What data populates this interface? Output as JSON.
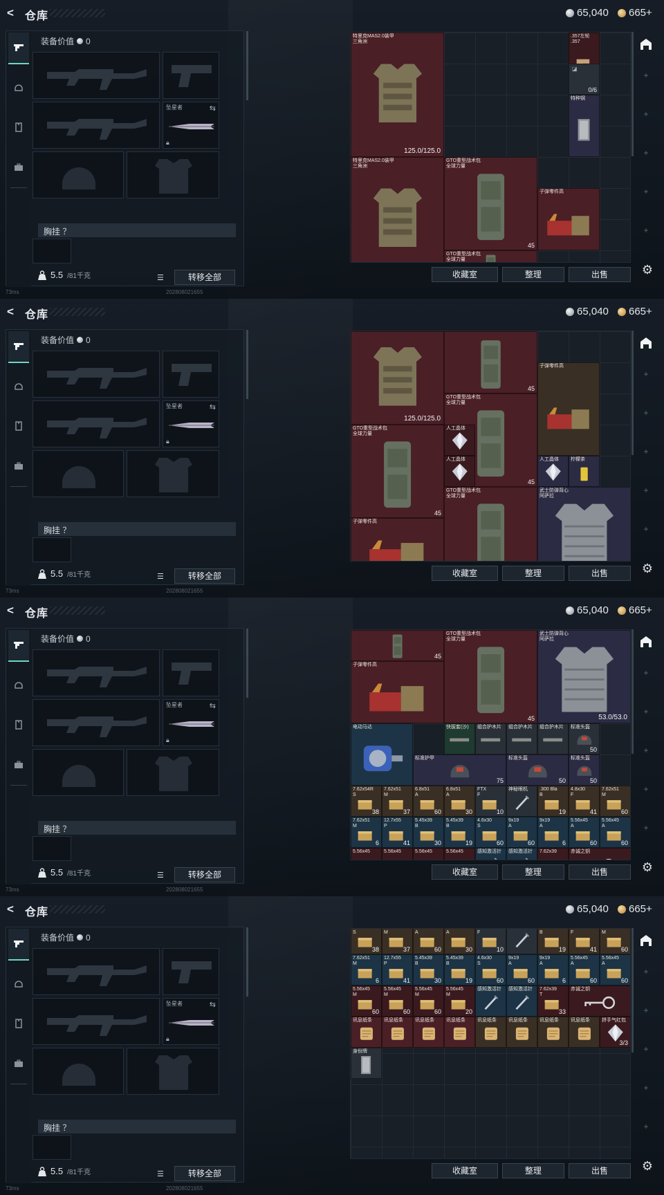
{
  "header": {
    "back": "<",
    "title": "仓库",
    "silver": "65,040",
    "gold": "665+"
  },
  "left": {
    "equip_value_label": "装备价值",
    "equip_value": "0",
    "melee_label": "坠星者",
    "chest_label": "胸挂 ？",
    "weight": "5.5",
    "weight_max": "/81千克",
    "transfer_all": "转移全部"
  },
  "status": {
    "ping": "73ms",
    "build": "202808021655"
  },
  "bottom": {
    "collection": "收藏室",
    "sort": "整理",
    "sell": "出售"
  },
  "screens": [
    {
      "items": [
        {
          "name": "特里克MAS2.0装甲\n三角洲",
          "dur": "125.0/125.0",
          "x": 0,
          "y": 0,
          "w": 3,
          "h": 4,
          "c": "red",
          "art": "vest"
        },
        {
          "name": ".357左轮\n.357",
          "x": 7,
          "y": 0,
          "w": 1,
          "h": 2,
          "c": "dkred",
          "art": "gun"
        },
        {
          "name": "",
          "count": "0/6",
          "x": 7,
          "y": 1,
          "w": 1,
          "h": 1,
          "c": "gray",
          "art": "ammo"
        },
        {
          "name": "特种钢",
          "x": 7,
          "y": 2,
          "w": 1,
          "h": 2,
          "c": "purple",
          "art": "steel"
        },
        {
          "name": "特里克MAS2.0装甲\n三角洲",
          "x": 0,
          "y": 4,
          "w": 3,
          "h": 4,
          "c": "red",
          "art": "vest"
        },
        {
          "name": "GTO重型战术包\n全球力量",
          "count": "45",
          "x": 3,
          "y": 4,
          "w": 3,
          "h": 3,
          "c": "red",
          "art": "pack"
        },
        {
          "name": "子弹零件高",
          "x": 6,
          "y": 5,
          "w": 2,
          "h": 2,
          "c": "red",
          "art": "parts"
        },
        {
          "name": "GTO重型战术包\n全球力量",
          "x": 3,
          "y": 7,
          "w": 3,
          "h": 1,
          "c": "red",
          "art": "pack"
        }
      ]
    },
    {
      "items": [
        {
          "name": "",
          "dur": "125.0/125.0",
          "x": 0,
          "y": 0,
          "w": 3,
          "h": 3,
          "c": "red",
          "art": "vest"
        },
        {
          "name": "",
          "count": "45",
          "x": 3,
          "y": 0,
          "w": 3,
          "h": 2,
          "c": "red",
          "art": "pack"
        },
        {
          "name": "子弹零件高",
          "x": 6,
          "y": 1,
          "w": 2,
          "h": 3,
          "c": "brown",
          "art": "parts"
        },
        {
          "name": "GTO重型战术包\n全球力量",
          "count": "45",
          "x": 3,
          "y": 2,
          "w": 3,
          "h": 3,
          "c": "red",
          "art": "pack"
        },
        {
          "name": "GTO重型战术包\n全球力量",
          "count": "45",
          "x": 0,
          "y": 3,
          "w": 3,
          "h": 3,
          "c": "red",
          "art": "pack"
        },
        {
          "name": "人工晶体",
          "x": 3,
          "y": 3,
          "w": 1,
          "h": 1,
          "c": "dkred",
          "art": "gem"
        },
        {
          "name": "人工晶体",
          "x": 3,
          "y": 4,
          "w": 1,
          "h": 1,
          "c": "dkred",
          "art": "gem"
        },
        {
          "name": "人工晶体",
          "x": 6,
          "y": 4,
          "w": 1,
          "h": 1,
          "c": "purple",
          "art": "gem"
        },
        {
          "name": "柠檬茶",
          "x": 7,
          "y": 4,
          "w": 1,
          "h": 1,
          "c": "purple",
          "art": "tea"
        },
        {
          "name": "GTO重型战术包\n全球力量",
          "x": 3,
          "y": 5,
          "w": 3,
          "h": 3,
          "c": "red",
          "art": "pack"
        },
        {
          "name": "武士防弹背心\n阿萨拉",
          "x": 6,
          "y": 5,
          "w": 3,
          "h": 3,
          "c": "purple",
          "art": "mesh"
        },
        {
          "name": "子弹零件高",
          "x": 0,
          "y": 6,
          "w": 3,
          "h": 2,
          "c": "red",
          "art": "parts"
        }
      ]
    },
    {
      "items": [
        {
          "name": "",
          "count": "45",
          "x": 0,
          "y": 0,
          "w": 3,
          "h": 1,
          "c": "red",
          "art": "pack"
        },
        {
          "name": "GTO重型战术包\n全球力量",
          "count": "45",
          "x": 3,
          "y": 0,
          "w": 3,
          "h": 3,
          "c": "red",
          "art": "pack"
        },
        {
          "name": "武士防弹背心\n阿萨拉",
          "dur": "53.0/53.0",
          "x": 6,
          "y": 0,
          "w": 3,
          "h": 3,
          "c": "purple",
          "art": "mesh"
        },
        {
          "name": "子弹零件高",
          "x": 0,
          "y": 1,
          "w": 3,
          "h": 2,
          "c": "red",
          "art": "parts"
        },
        {
          "name": "电动马达",
          "x": 0,
          "y": 3,
          "w": 2,
          "h": 2,
          "c": "blue",
          "art": "motor"
        },
        {
          "name": "快拔套(沙)",
          "x": 3,
          "y": 3,
          "w": 1,
          "h": 1,
          "c": "green",
          "art": "bar"
        },
        {
          "name": "组合护木片",
          "x": 4,
          "y": 3,
          "w": 1,
          "h": 1,
          "c": "gray",
          "art": "bar"
        },
        {
          "name": "组合护木片",
          "x": 5,
          "y": 3,
          "w": 1,
          "h": 1,
          "c": "gray",
          "art": "bar"
        },
        {
          "name": "组合护木片",
          "x": 6,
          "y": 3,
          "w": 1,
          "h": 1,
          "c": "gray",
          "art": "bar"
        },
        {
          "name": "标准头盔",
          "count": "50",
          "x": 7,
          "y": 3,
          "w": 1,
          "h": 1,
          "c": "gray",
          "art": "helmet"
        },
        {
          "name": "标准护甲",
          "count": "75",
          "x": 2,
          "y": 4,
          "w": 3,
          "h": 1,
          "c": "purple",
          "art": "helmet"
        },
        {
          "name": "标准头盔",
          "count": "50",
          "x": 5,
          "y": 4,
          "w": 2,
          "h": 1,
          "c": "purple",
          "art": "helmet"
        },
        {
          "name": "标准头盔",
          "count": "50",
          "x": 7,
          "y": 4,
          "w": 1,
          "h": 1,
          "c": "purple",
          "art": "helmet"
        },
        {
          "name": "7.62x54R\nS",
          "count": "38",
          "x": 0,
          "y": 5,
          "w": 1,
          "h": 1,
          "c": "brown",
          "art": "box"
        },
        {
          "name": "7.62x51\nM",
          "count": "37",
          "x": 1,
          "y": 5,
          "w": 1,
          "h": 1,
          "c": "brown",
          "art": "box"
        },
        {
          "name": "6.8x51\nA",
          "count": "60",
          "x": 2,
          "y": 5,
          "w": 1,
          "h": 1,
          "c": "brown",
          "art": "box"
        },
        {
          "name": "6.8x51\nA",
          "count": "30",
          "x": 3,
          "y": 5,
          "w": 1,
          "h": 1,
          "c": "brown",
          "art": "box"
        },
        {
          "name": "FTX\nF",
          "count": "10",
          "x": 4,
          "y": 5,
          "w": 1,
          "h": 1,
          "c": "gray",
          "art": "box"
        },
        {
          "name": "神秘眼机",
          "x": 5,
          "y": 5,
          "w": 1,
          "h": 1,
          "c": "gray",
          "art": "pipe"
        },
        {
          "name": ".300 Bla\nB",
          "count": "19",
          "x": 6,
          "y": 5,
          "w": 1,
          "h": 1,
          "c": "brown",
          "art": "box"
        },
        {
          "name": "4.8x30\nF",
          "count": "41",
          "x": 7,
          "y": 5,
          "w": 1,
          "h": 1,
          "c": "brown",
          "art": "box"
        },
        {
          "name": "7.62x51\nM",
          "count": "60",
          "x": 8,
          "y": 5,
          "w": 1,
          "h": 1,
          "c": "brown",
          "art": "box"
        },
        {
          "name": "7.62x51\nM",
          "count": "6",
          "x": 0,
          "y": 6,
          "w": 1,
          "h": 1,
          "c": "blue",
          "art": "box"
        },
        {
          "name": "12.7x55\nP",
          "count": "41",
          "x": 1,
          "y": 6,
          "w": 1,
          "h": 1,
          "c": "blue",
          "art": "box"
        },
        {
          "name": "5.45x39\nB",
          "count": "30",
          "x": 2,
          "y": 6,
          "w": 1,
          "h": 1,
          "c": "blue",
          "art": "box"
        },
        {
          "name": "5.45x39\nB",
          "count": "19",
          "x": 3,
          "y": 6,
          "w": 1,
          "h": 1,
          "c": "blue",
          "art": "box"
        },
        {
          "name": "4.6x30\nS",
          "count": "60",
          "x": 4,
          "y": 6,
          "w": 1,
          "h": 1,
          "c": "blue",
          "art": "box"
        },
        {
          "name": "9x19\nA",
          "count": "60",
          "x": 5,
          "y": 6,
          "w": 1,
          "h": 1,
          "c": "blue",
          "art": "box"
        },
        {
          "name": "9x19\nA",
          "count": "6",
          "x": 6,
          "y": 6,
          "w": 1,
          "h": 1,
          "c": "blue",
          "art": "box"
        },
        {
          "name": "5.56x45\nA",
          "count": "60",
          "x": 7,
          "y": 6,
          "w": 1,
          "h": 1,
          "c": "blue",
          "art": "box"
        },
        {
          "name": "5.56x45\nA",
          "count": "60",
          "x": 8,
          "y": 6,
          "w": 1,
          "h": 1,
          "c": "blue",
          "art": "box"
        },
        {
          "name": "5.56x45",
          "x": 0,
          "y": 7,
          "w": 1,
          "h": 1,
          "c": "dkred",
          "art": "box"
        },
        {
          "name": "5.56x45",
          "x": 1,
          "y": 7,
          "w": 1,
          "h": 1,
          "c": "dkred",
          "art": "box"
        },
        {
          "name": "5.56x45",
          "x": 2,
          "y": 7,
          "w": 1,
          "h": 1,
          "c": "dkred",
          "art": "box"
        },
        {
          "name": "5.56x45",
          "x": 3,
          "y": 7,
          "w": 1,
          "h": 1,
          "c": "dkred",
          "art": "box"
        },
        {
          "name": "感知激活针",
          "x": 4,
          "y": 7,
          "w": 1,
          "h": 1,
          "c": "blue",
          "art": "pipe"
        },
        {
          "name": "感知激活针",
          "x": 5,
          "y": 7,
          "w": 1,
          "h": 1,
          "c": "blue",
          "art": "pipe"
        },
        {
          "name": "7.62x39",
          "x": 6,
          "y": 7,
          "w": 1,
          "h": 1,
          "c": "dkred",
          "art": "box"
        },
        {
          "name": "赤诚之钥",
          "x": 7,
          "y": 7,
          "w": 2,
          "h": 1,
          "c": "dkred",
          "art": "key"
        }
      ]
    },
    {
      "items": [
        {
          "name": "7.62x54R\nS",
          "count": "38",
          "x": 0,
          "y": 0,
          "w": 1,
          "h": 1,
          "c": "brown",
          "art": "box"
        },
        {
          "name": "7.62x51\nM",
          "count": "37",
          "x": 1,
          "y": 0,
          "w": 1,
          "h": 1,
          "c": "brown",
          "art": "box"
        },
        {
          "name": "6.8x51\nA",
          "count": "60",
          "x": 2,
          "y": 0,
          "w": 1,
          "h": 1,
          "c": "brown",
          "art": "box"
        },
        {
          "name": "6.8x51\nA",
          "count": "30",
          "x": 3,
          "y": 0,
          "w": 1,
          "h": 1,
          "c": "brown",
          "art": "box"
        },
        {
          "name": "FTX\nF",
          "count": "10",
          "x": 4,
          "y": 0,
          "w": 1,
          "h": 1,
          "c": "gray",
          "art": "box"
        },
        {
          "name": "神秘眼机",
          "x": 5,
          "y": 0,
          "w": 1,
          "h": 1,
          "c": "gray",
          "art": "pipe"
        },
        {
          "name": ".300 Bla\nB",
          "count": "19",
          "x": 6,
          "y": 0,
          "w": 1,
          "h": 1,
          "c": "brown",
          "art": "box"
        },
        {
          "name": "4.8x30\nF",
          "count": "41",
          "x": 7,
          "y": 0,
          "w": 1,
          "h": 1,
          "c": "brown",
          "art": "box"
        },
        {
          "name": "7.62x51\nM",
          "count": "60",
          "x": 8,
          "y": 0,
          "w": 1,
          "h": 1,
          "c": "brown",
          "art": "box"
        },
        {
          "name": "7.62x51\nM",
          "count": "6",
          "x": 0,
          "y": 1,
          "w": 1,
          "h": 1,
          "c": "blue",
          "art": "box"
        },
        {
          "name": "12.7x55\nP",
          "count": "41",
          "x": 1,
          "y": 1,
          "w": 1,
          "h": 1,
          "c": "blue",
          "art": "box"
        },
        {
          "name": "5.45x39\nB",
          "count": "30",
          "x": 2,
          "y": 1,
          "w": 1,
          "h": 1,
          "c": "blue",
          "art": "box"
        },
        {
          "name": "5.45x39\nB",
          "count": "19",
          "x": 3,
          "y": 1,
          "w": 1,
          "h": 1,
          "c": "blue",
          "art": "box"
        },
        {
          "name": "4.6x30\nS",
          "count": "60",
          "x": 4,
          "y": 1,
          "w": 1,
          "h": 1,
          "c": "blue",
          "art": "box"
        },
        {
          "name": "9x19\nA",
          "count": "60",
          "x": 5,
          "y": 1,
          "w": 1,
          "h": 1,
          "c": "blue",
          "art": "box"
        },
        {
          "name": "9x19\nA",
          "count": "6",
          "x": 6,
          "y": 1,
          "w": 1,
          "h": 1,
          "c": "blue",
          "art": "box"
        },
        {
          "name": "5.56x45\nA",
          "count": "60",
          "x": 7,
          "y": 1,
          "w": 1,
          "h": 1,
          "c": "blue",
          "art": "box"
        },
        {
          "name": "5.56x45\nA",
          "count": "60",
          "x": 8,
          "y": 1,
          "w": 1,
          "h": 1,
          "c": "blue",
          "art": "box"
        },
        {
          "name": "5.56x45\nM",
          "count": "60",
          "x": 0,
          "y": 2,
          "w": 1,
          "h": 1,
          "c": "dkred",
          "art": "box"
        },
        {
          "name": "5.56x45\nM",
          "count": "60",
          "x": 1,
          "y": 2,
          "w": 1,
          "h": 1,
          "c": "dkred",
          "art": "box"
        },
        {
          "name": "5.56x45\nM",
          "count": "60",
          "x": 2,
          "y": 2,
          "w": 1,
          "h": 1,
          "c": "dkred",
          "art": "box"
        },
        {
          "name": "5.56x45\nM",
          "count": "20",
          "x": 3,
          "y": 2,
          "w": 1,
          "h": 1,
          "c": "dkred",
          "art": "box"
        },
        {
          "name": "感知激活针",
          "x": 4,
          "y": 2,
          "w": 1,
          "h": 1,
          "c": "blue",
          "art": "pipe"
        },
        {
          "name": "感知激活针",
          "x": 5,
          "y": 2,
          "w": 1,
          "h": 1,
          "c": "blue",
          "art": "pipe"
        },
        {
          "name": "7.62x39\nT",
          "count": "33",
          "x": 6,
          "y": 2,
          "w": 1,
          "h": 1,
          "c": "dkred",
          "art": "box"
        },
        {
          "name": "赤诚之钥",
          "x": 7,
          "y": 2,
          "w": 2,
          "h": 1,
          "c": "dkred",
          "art": "key"
        },
        {
          "name": "讯息纸条",
          "x": 0,
          "y": 3,
          "w": 1,
          "h": 1,
          "c": "red",
          "art": "paper"
        },
        {
          "name": "讯息纸条",
          "x": 1,
          "y": 3,
          "w": 1,
          "h": 1,
          "c": "red",
          "art": "paper"
        },
        {
          "name": "讯息纸条",
          "x": 2,
          "y": 3,
          "w": 1,
          "h": 1,
          "c": "red",
          "art": "paper"
        },
        {
          "name": "讯息纸条",
          "x": 3,
          "y": 3,
          "w": 1,
          "h": 1,
          "c": "red",
          "art": "paper"
        },
        {
          "name": "讯息纸条",
          "x": 4,
          "y": 3,
          "w": 1,
          "h": 1,
          "c": "brown",
          "art": "paper"
        },
        {
          "name": "讯息纸条",
          "x": 5,
          "y": 3,
          "w": 1,
          "h": 1,
          "c": "brown",
          "art": "paper"
        },
        {
          "name": "讯息纸条",
          "x": 6,
          "y": 3,
          "w": 1,
          "h": 1,
          "c": "brown",
          "art": "paper"
        },
        {
          "name": "讯息纸条",
          "x": 7,
          "y": 3,
          "w": 1,
          "h": 1,
          "c": "brown",
          "art": "paper"
        },
        {
          "name": "拼手气红包",
          "count": "3/3",
          "x": 8,
          "y": 3,
          "w": 1,
          "h": 1,
          "c": "dkred",
          "art": "gem"
        },
        {
          "name": "身份牌",
          "x": 0,
          "y": 4,
          "w": 1,
          "h": 1,
          "c": "gray",
          "art": "steel"
        }
      ]
    }
  ]
}
